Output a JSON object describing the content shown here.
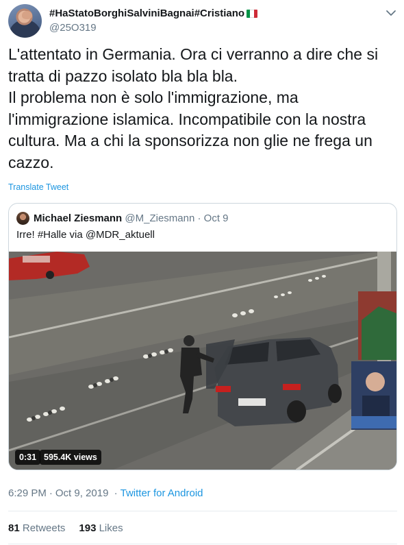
{
  "author": {
    "display_name": "#HaStatoBorghiSalviniBagnai#Cristiano",
    "handle": "@25O319",
    "flag_colors": [
      "#009246",
      "#ffffff",
      "#ce2b37"
    ]
  },
  "tweet": {
    "lines": [
      "L'attentato in Germania. Ora ci verranno a dire che si",
      "tratta di pazzo isolato bla bla bla.",
      "Il problema non è solo l'immigrazione, ma",
      "l'immigrazione islamica. Incompatibile con la nostra",
      "cultura. Ma a chi la sponsorizza non glie ne frega un",
      "cazzo."
    ],
    "translate_label": "Translate Tweet"
  },
  "quoted": {
    "name": "Michael Ziesmann",
    "handle": "@M_Ziesmann",
    "separator": "·",
    "date": "Oct 9",
    "text": "Irre! #Halle via @MDR_aktuell",
    "video": {
      "duration": "0:31",
      "views": "595.4K views"
    }
  },
  "meta": {
    "time": "6:29 PM",
    "separator": "·",
    "date": "Oct 9, 2019",
    "source": "Twitter for Android"
  },
  "stats": {
    "retweets_count": "81",
    "retweets_label": "Retweets",
    "likes_count": "193",
    "likes_label": "Likes"
  },
  "colors": {
    "link_blue": "#1b95e0",
    "secondary_text": "#657786",
    "border": "#ccd6dd"
  },
  "icons": {
    "caret": "chevron-down-icon"
  }
}
